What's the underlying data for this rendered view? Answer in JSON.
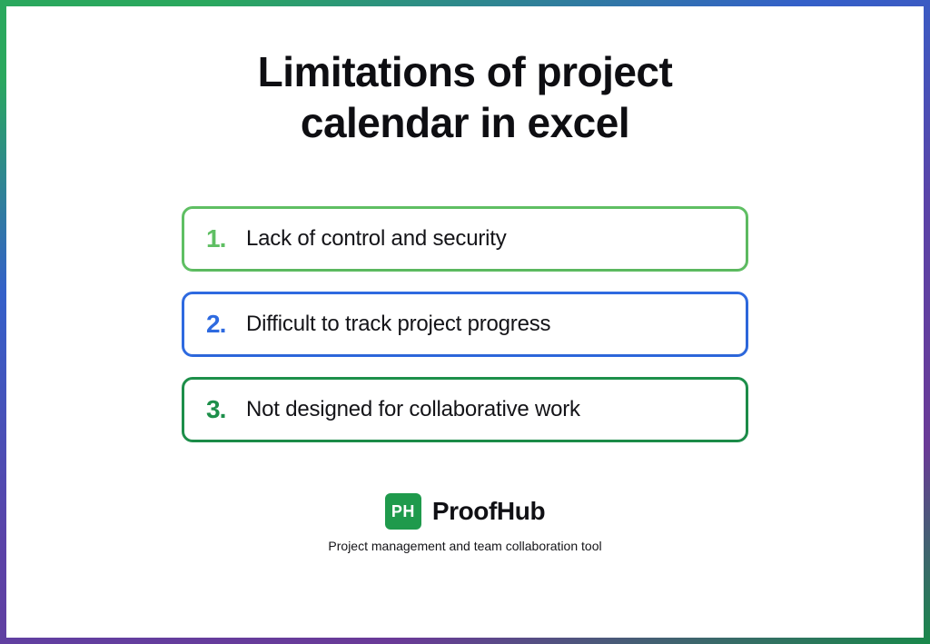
{
  "title": "Limitations of project calendar in excel",
  "items": [
    {
      "num": "1.",
      "text": "Lack of control and security"
    },
    {
      "num": "2.",
      "text": "Difficult to track project progress"
    },
    {
      "num": "3.",
      "text": "Not designed for collaborative work"
    }
  ],
  "brand": {
    "mark": "PH",
    "name": "ProofHub",
    "tagline": "Project management and team collaboration tool"
  }
}
